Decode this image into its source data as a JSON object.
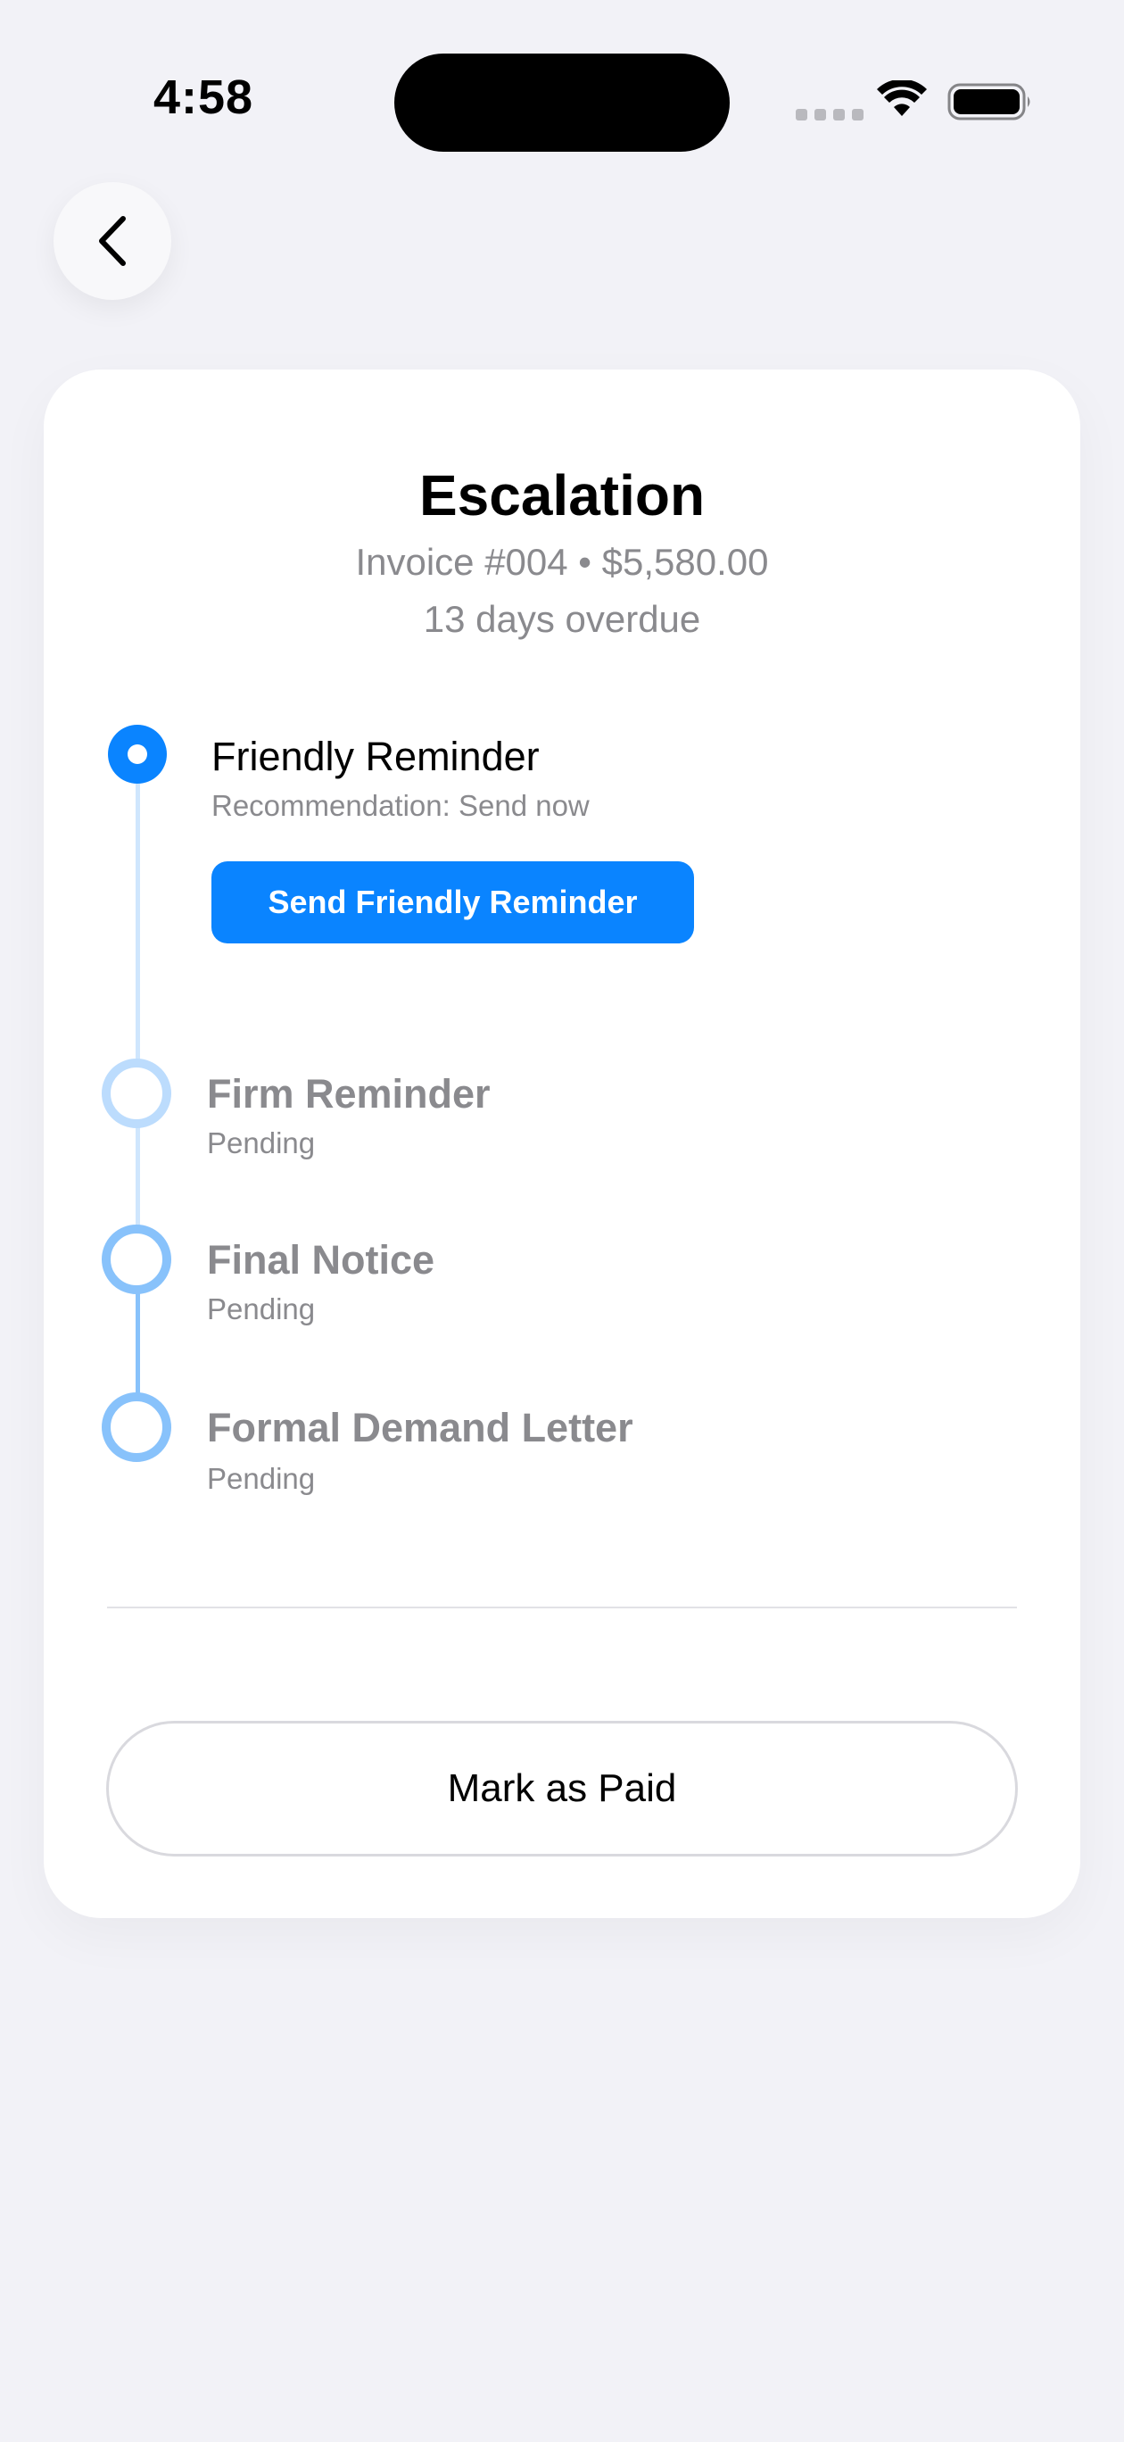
{
  "status_bar": {
    "time": "4:58"
  },
  "nav": {
    "back_icon": "chevron-left-icon"
  },
  "card": {
    "title": "Escalation",
    "subtitle": "Invoice #004 • $5,580.00",
    "overdue": "13 days overdue"
  },
  "steps": [
    {
      "title": "Friendly Reminder",
      "subtitle": "Recommendation: Send now",
      "state": "active",
      "action_label": "Send Friendly Reminder"
    },
    {
      "title": "Firm Reminder",
      "subtitle": "Pending",
      "state": "pending"
    },
    {
      "title": "Final Notice",
      "subtitle": "Pending",
      "state": "pending"
    },
    {
      "title": "Formal Demand Letter",
      "subtitle": "Pending",
      "state": "pending"
    }
  ],
  "footer": {
    "mark_paid_label": "Mark as Paid"
  },
  "colors": {
    "accent": "#0a84ff",
    "pending_ring": "#88c2fb",
    "muted_text": "#8a8a8e",
    "background": "#f2f2f7"
  }
}
